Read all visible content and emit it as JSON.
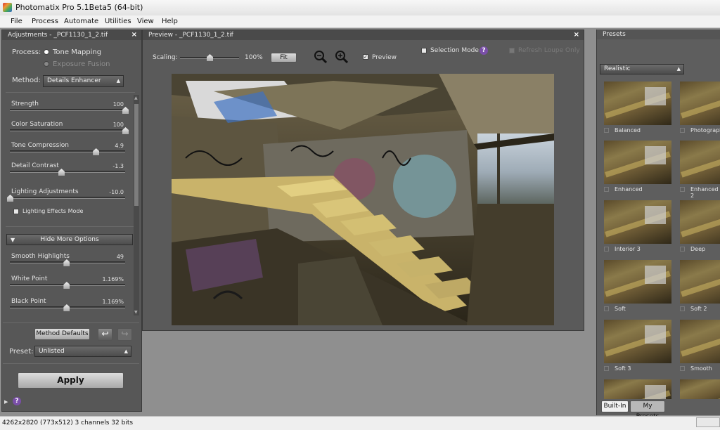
{
  "window": {
    "title": "Photomatix Pro 5.1Beta5 (64-bit)"
  },
  "menu": [
    "File",
    "Process",
    "Automate",
    "Utilities",
    "View",
    "Help"
  ],
  "adjustments": {
    "panel_title": "Adjustments - _PCF1130_1_2.tif",
    "process_label": "Process:",
    "process_options": [
      "Tone Mapping",
      "Exposure Fusion"
    ],
    "method_label": "Method:",
    "method_value": "Details Enhancer",
    "sliders": [
      {
        "label": "Strength",
        "value": "100",
        "fraction": 1.0
      },
      {
        "label": "Color Saturation",
        "value": "100",
        "fraction": 1.0
      },
      {
        "label": "Tone Compression",
        "value": "4.9",
        "fraction": 0.745
      },
      {
        "label": "Detail Contrast",
        "value": "-1.3",
        "fraction": 0.445
      },
      {
        "label": "Lighting Adjustments",
        "value": "-10.0",
        "fraction": 0.0
      }
    ],
    "lighting_effects_mode": "Lighting Effects Mode",
    "hide_more_options": "Hide More Options",
    "more_sliders": [
      {
        "label": "Smooth Highlights",
        "value": "49",
        "fraction": 0.49
      },
      {
        "label": "White Point",
        "value": "1.169%",
        "fraction": 0.49
      },
      {
        "label": "Black Point",
        "value": "1.169%",
        "fraction": 0.49
      }
    ],
    "method_defaults": "Method Defaults",
    "preset_label": "Preset:",
    "preset_value": "Unlisted",
    "apply": "Apply"
  },
  "preview": {
    "panel_title": "Preview - _PCF1130_1_2.tif",
    "scaling_label": "Scaling:",
    "scaling_value": "100%",
    "scaling_fraction": 0.5,
    "fit": "Fit",
    "preview_label": "Preview",
    "selection_mode": "Selection Mode",
    "refresh": "Refresh Loupe Only"
  },
  "presets": {
    "panel_title": "Presets",
    "category": "Realistic",
    "items": [
      "Balanced",
      "Photographic",
      "Enhanced",
      "Enhanced 2",
      "Interior 3",
      "Deep",
      "Soft",
      "Soft 2",
      "Soft 3",
      "Smooth"
    ],
    "tabs": [
      "Built-In",
      "My Presets"
    ]
  },
  "status": {
    "text": "4262x2820 (773x512) 3 channels 32 bits"
  },
  "colors": {
    "accent": "#7a4fa8",
    "panel": "#575757"
  }
}
